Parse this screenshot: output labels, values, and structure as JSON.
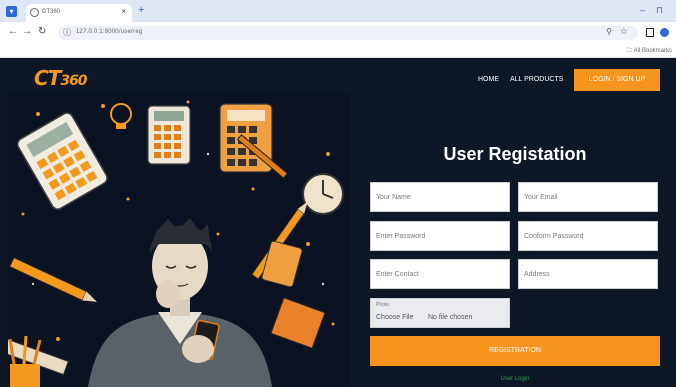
{
  "browser": {
    "tab_title": "CT360",
    "tab_close": "×",
    "new_tab": "+",
    "url": "127.0.0.1:8000/userreg",
    "window_controls": {
      "minimize": "–",
      "maximize": "⊓"
    },
    "bookmarks_folder": "All Bookmarks",
    "accent": "#2f67d8"
  },
  "site": {
    "logo": {
      "main": "CT",
      "suffix": "360"
    },
    "nav": {
      "home": "HOME",
      "products": "ALL PRODUCTS",
      "login": "LOGIN / SIGN UP"
    },
    "colors": {
      "background": "#0e1726",
      "accent": "#f7941d",
      "link": "#2ea44f"
    }
  },
  "form": {
    "title": "User Registation",
    "name_placeholder": "Your Name",
    "email_placeholder": "Your Email",
    "password_placeholder": "Enter Password",
    "confirm_placeholder": "Conform Password",
    "contact_placeholder": "Enter Contact",
    "address_placeholder": "Address",
    "photo_label": "Photo",
    "choose_file": "Choose File",
    "no_file": "No file chosen",
    "submit": "REGISTRATION",
    "login_link": "User Login"
  }
}
